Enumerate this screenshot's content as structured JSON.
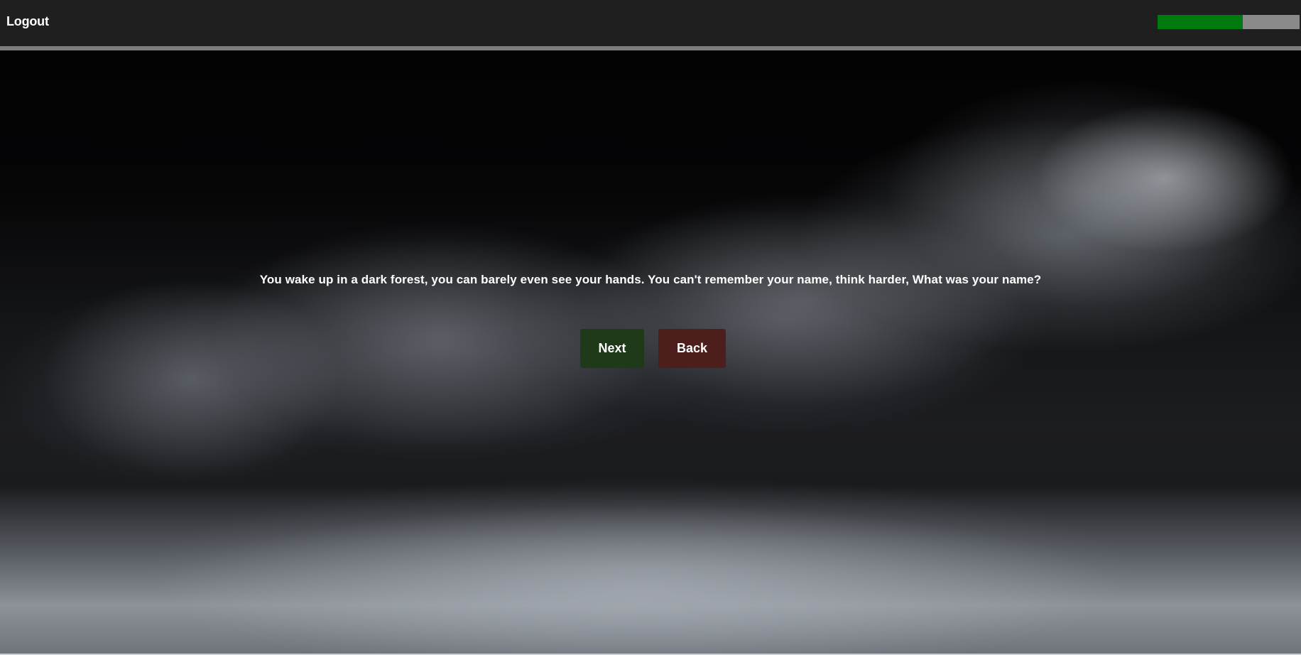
{
  "header": {
    "logout_label": "Logout",
    "progress": 0.6
  },
  "story": {
    "text": "You wake up in a dark forest, you can barely even see your hands. You can't remember your name, think harder, What was your name?"
  },
  "actions": {
    "next_label": "Next",
    "back_label": "Back"
  },
  "colors": {
    "progress_fill": "#007a10",
    "progress_track": "#8a8a8a",
    "next_button": "#1e3a18",
    "back_button": "#4d1e1b",
    "topbar": "#1f1f1f"
  }
}
